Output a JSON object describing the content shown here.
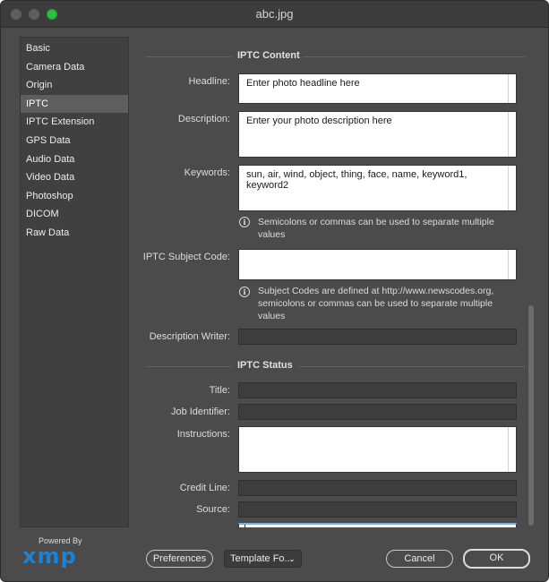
{
  "window": {
    "title": "abc.jpg"
  },
  "sidebar": {
    "items": [
      {
        "label": "Basic"
      },
      {
        "label": "Camera Data"
      },
      {
        "label": "Origin"
      },
      {
        "label": "IPTC"
      },
      {
        "label": "IPTC Extension"
      },
      {
        "label": "GPS Data"
      },
      {
        "label": "Audio Data"
      },
      {
        "label": "Video Data"
      },
      {
        "label": "Photoshop"
      },
      {
        "label": "DICOM"
      },
      {
        "label": "Raw Data"
      }
    ],
    "selected": "IPTC"
  },
  "iptc_content": {
    "heading": "IPTC Content",
    "headline": {
      "label": "Headline:",
      "value": "Enter photo headline here"
    },
    "description": {
      "label": "Description:",
      "value": "Enter your photo description here"
    },
    "keywords": {
      "label": "Keywords:",
      "value": "sun, air, wind, object, thing, face, name, keyword1, keyword2"
    },
    "keywords_hint": "Semicolons or commas can be used to separate multiple values",
    "subject_code": {
      "label": "IPTC Subject Code:",
      "value": ""
    },
    "subject_code_hint": "Subject Codes are defined at http://www.newscodes.org, semicolons or commas can be used to separate multiple values",
    "description_writer": {
      "label": "Description Writer:",
      "value": ""
    }
  },
  "iptc_status": {
    "heading": "IPTC Status",
    "title": {
      "label": "Title:",
      "value": ""
    },
    "job_identifier": {
      "label": "Job Identifier:",
      "value": ""
    },
    "instructions": {
      "label": "Instructions:",
      "value": ""
    },
    "credit_line": {
      "label": "Credit Line:",
      "value": ""
    },
    "source": {
      "label": "Source:",
      "value": ""
    }
  },
  "footer": {
    "powered_by": "Powered By",
    "logo_text": "xmp",
    "preferences_label": "Preferences",
    "template_label": "Template Fo...",
    "cancel_label": "Cancel",
    "ok_label": "OK"
  },
  "colors": {
    "window_bg": "#4b4b4b",
    "selected_item": "#5e5e5e",
    "accent_logo": "#1e82d2",
    "maximize_button": "#2ac13e"
  }
}
